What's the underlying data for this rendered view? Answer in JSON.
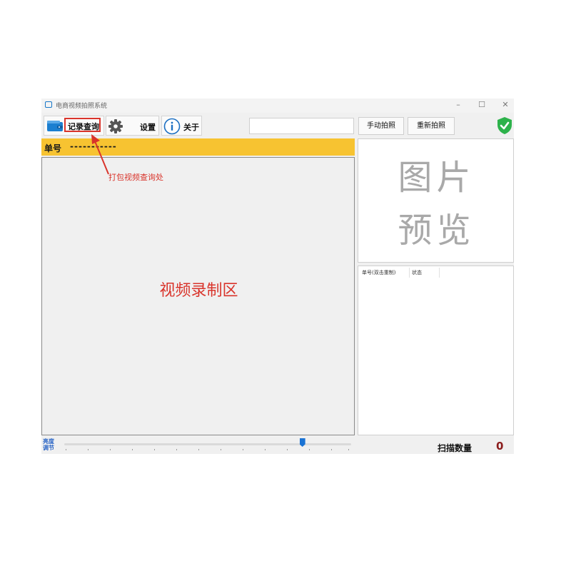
{
  "window": {
    "title": "电商视频拍照系统",
    "controls": {
      "minimize": "–",
      "maximize": "☐",
      "close": "✕"
    }
  },
  "toolbar": {
    "records_label": "记录查询",
    "settings_label": "设置",
    "about_label": "关于",
    "search_value": "",
    "manual_capture_label": "手动拍照",
    "recapture_label": "重新拍照"
  },
  "order": {
    "label": "单号",
    "value": "-----------"
  },
  "annotation": {
    "text": "打包视频查询处"
  },
  "video": {
    "label": "视频录制区"
  },
  "preview": {
    "line1": "图片",
    "line2": "预览"
  },
  "list": {
    "columns": [
      "单号(双击重制)",
      "状态"
    ]
  },
  "bottom": {
    "brightness_label_1": "亮度",
    "brightness_label_2": "调节",
    "brightness_fraction": 0.83,
    "scan_label": "扫描数量",
    "scan_count": "0"
  },
  "colors": {
    "order_bar": "#f7c331",
    "annotation_red": "#d9342b",
    "slider_blue": "#1a73d4",
    "shield_green": "#2db24b",
    "count_red": "#8b1d1d"
  },
  "icons": [
    "wallet-icon",
    "gear-icon",
    "info-icon",
    "shield-check-icon"
  ]
}
